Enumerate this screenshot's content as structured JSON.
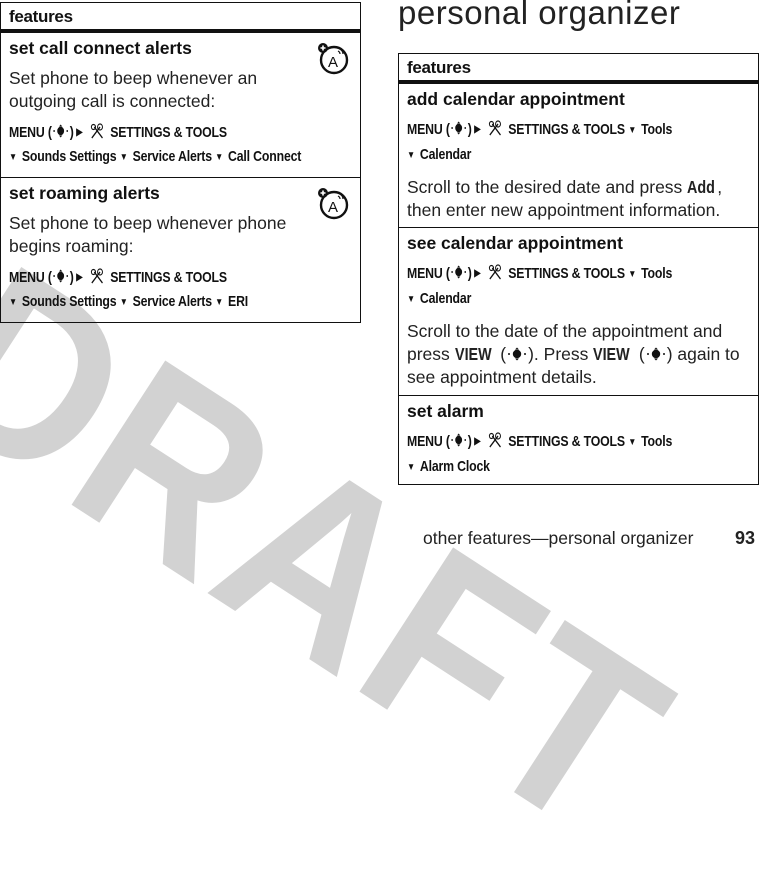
{
  "watermark": "DRAFT",
  "page_title": "personal organizer",
  "left_table": {
    "header": "features",
    "rows": [
      {
        "title": "set call connect alerts",
        "icon": "network-feature-icon",
        "desc": "Set phone to beep whenever an outgoing call is connected:",
        "path": {
          "menu": "MENU",
          "nav_icon": "nav-key-center-icon",
          "tools_icon": "settings-tools-icon",
          "items": [
            "SETTINGS & TOOLS",
            "Sounds Settings",
            "Service Alerts",
            "Call Connect"
          ]
        }
      },
      {
        "title": "set roaming alerts",
        "icon": "network-feature-icon",
        "desc": "Set phone to beep whenever phone begins roaming:",
        "path": {
          "menu": "MENU",
          "nav_icon": "nav-key-center-icon",
          "tools_icon": "settings-tools-icon",
          "items": [
            "SETTINGS & TOOLS",
            "Sounds Settings",
            "Service Alerts",
            "ERI"
          ]
        }
      }
    ]
  },
  "right_table": {
    "header": "features",
    "rows": [
      {
        "title": "add calendar appointment",
        "path": {
          "menu": "MENU",
          "items": [
            "SETTINGS & TOOLS",
            "Tools",
            "Calendar"
          ]
        },
        "desc_parts": [
          "Scroll to the desired date and press ",
          "Add",
          ", then enter new appointment information."
        ]
      },
      {
        "title": "see calendar appointment",
        "path": {
          "menu": "MENU",
          "items": [
            "SETTINGS & TOOLS",
            "Tools",
            "Calendar"
          ]
        },
        "desc_parts": [
          "Scroll to the date of the appointment and press ",
          "VIEW",
          ". Press ",
          "VIEW",
          " again to see appointment details."
        ]
      },
      {
        "title": "set alarm",
        "path": {
          "menu": "MENU",
          "items": [
            "SETTINGS & TOOLS",
            "Tools",
            "Alarm Clock"
          ]
        }
      }
    ]
  },
  "footer": {
    "section": "other features—personal organizer",
    "page_number": "93"
  }
}
